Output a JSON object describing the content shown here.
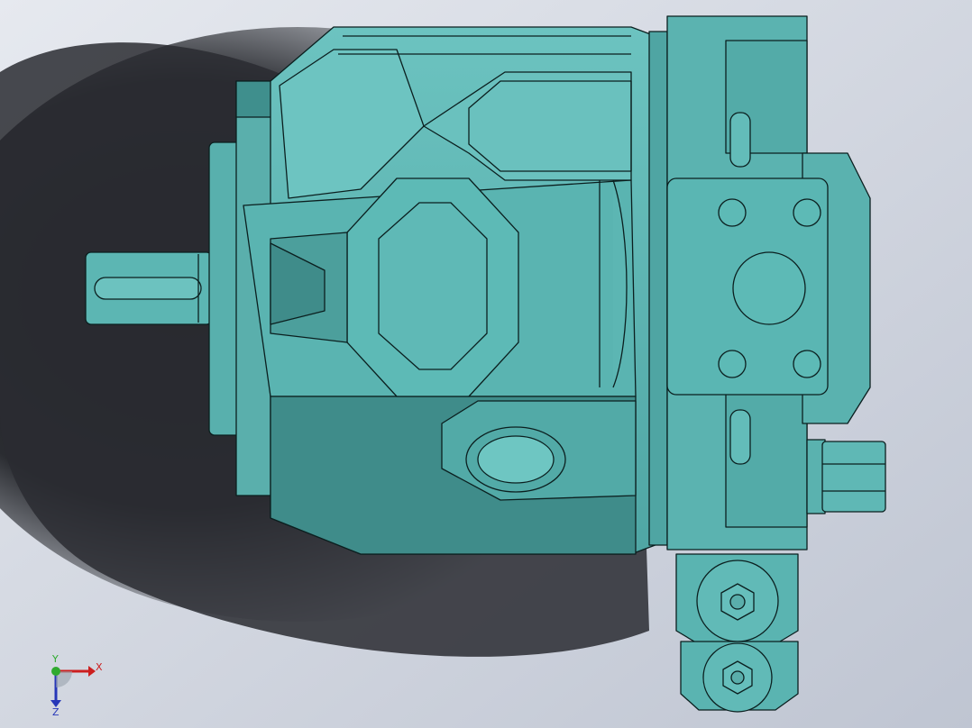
{
  "viewport": {
    "background_top": "#d9dde6",
    "background_bottom": "#c7ccd8",
    "shadow_color": "#26282d",
    "model_fill": "#5cb6b3",
    "model_fill_dark": "#3f8c8a",
    "model_fill_light": "#76cac6",
    "edge_color": "#0b1f1f"
  },
  "triad": {
    "x_label": "X",
    "y_label": "Y",
    "z_label": "Z",
    "x_color": "#cc1f1f",
    "y_color": "#2faa2f",
    "z_color": "#2637b8"
  }
}
